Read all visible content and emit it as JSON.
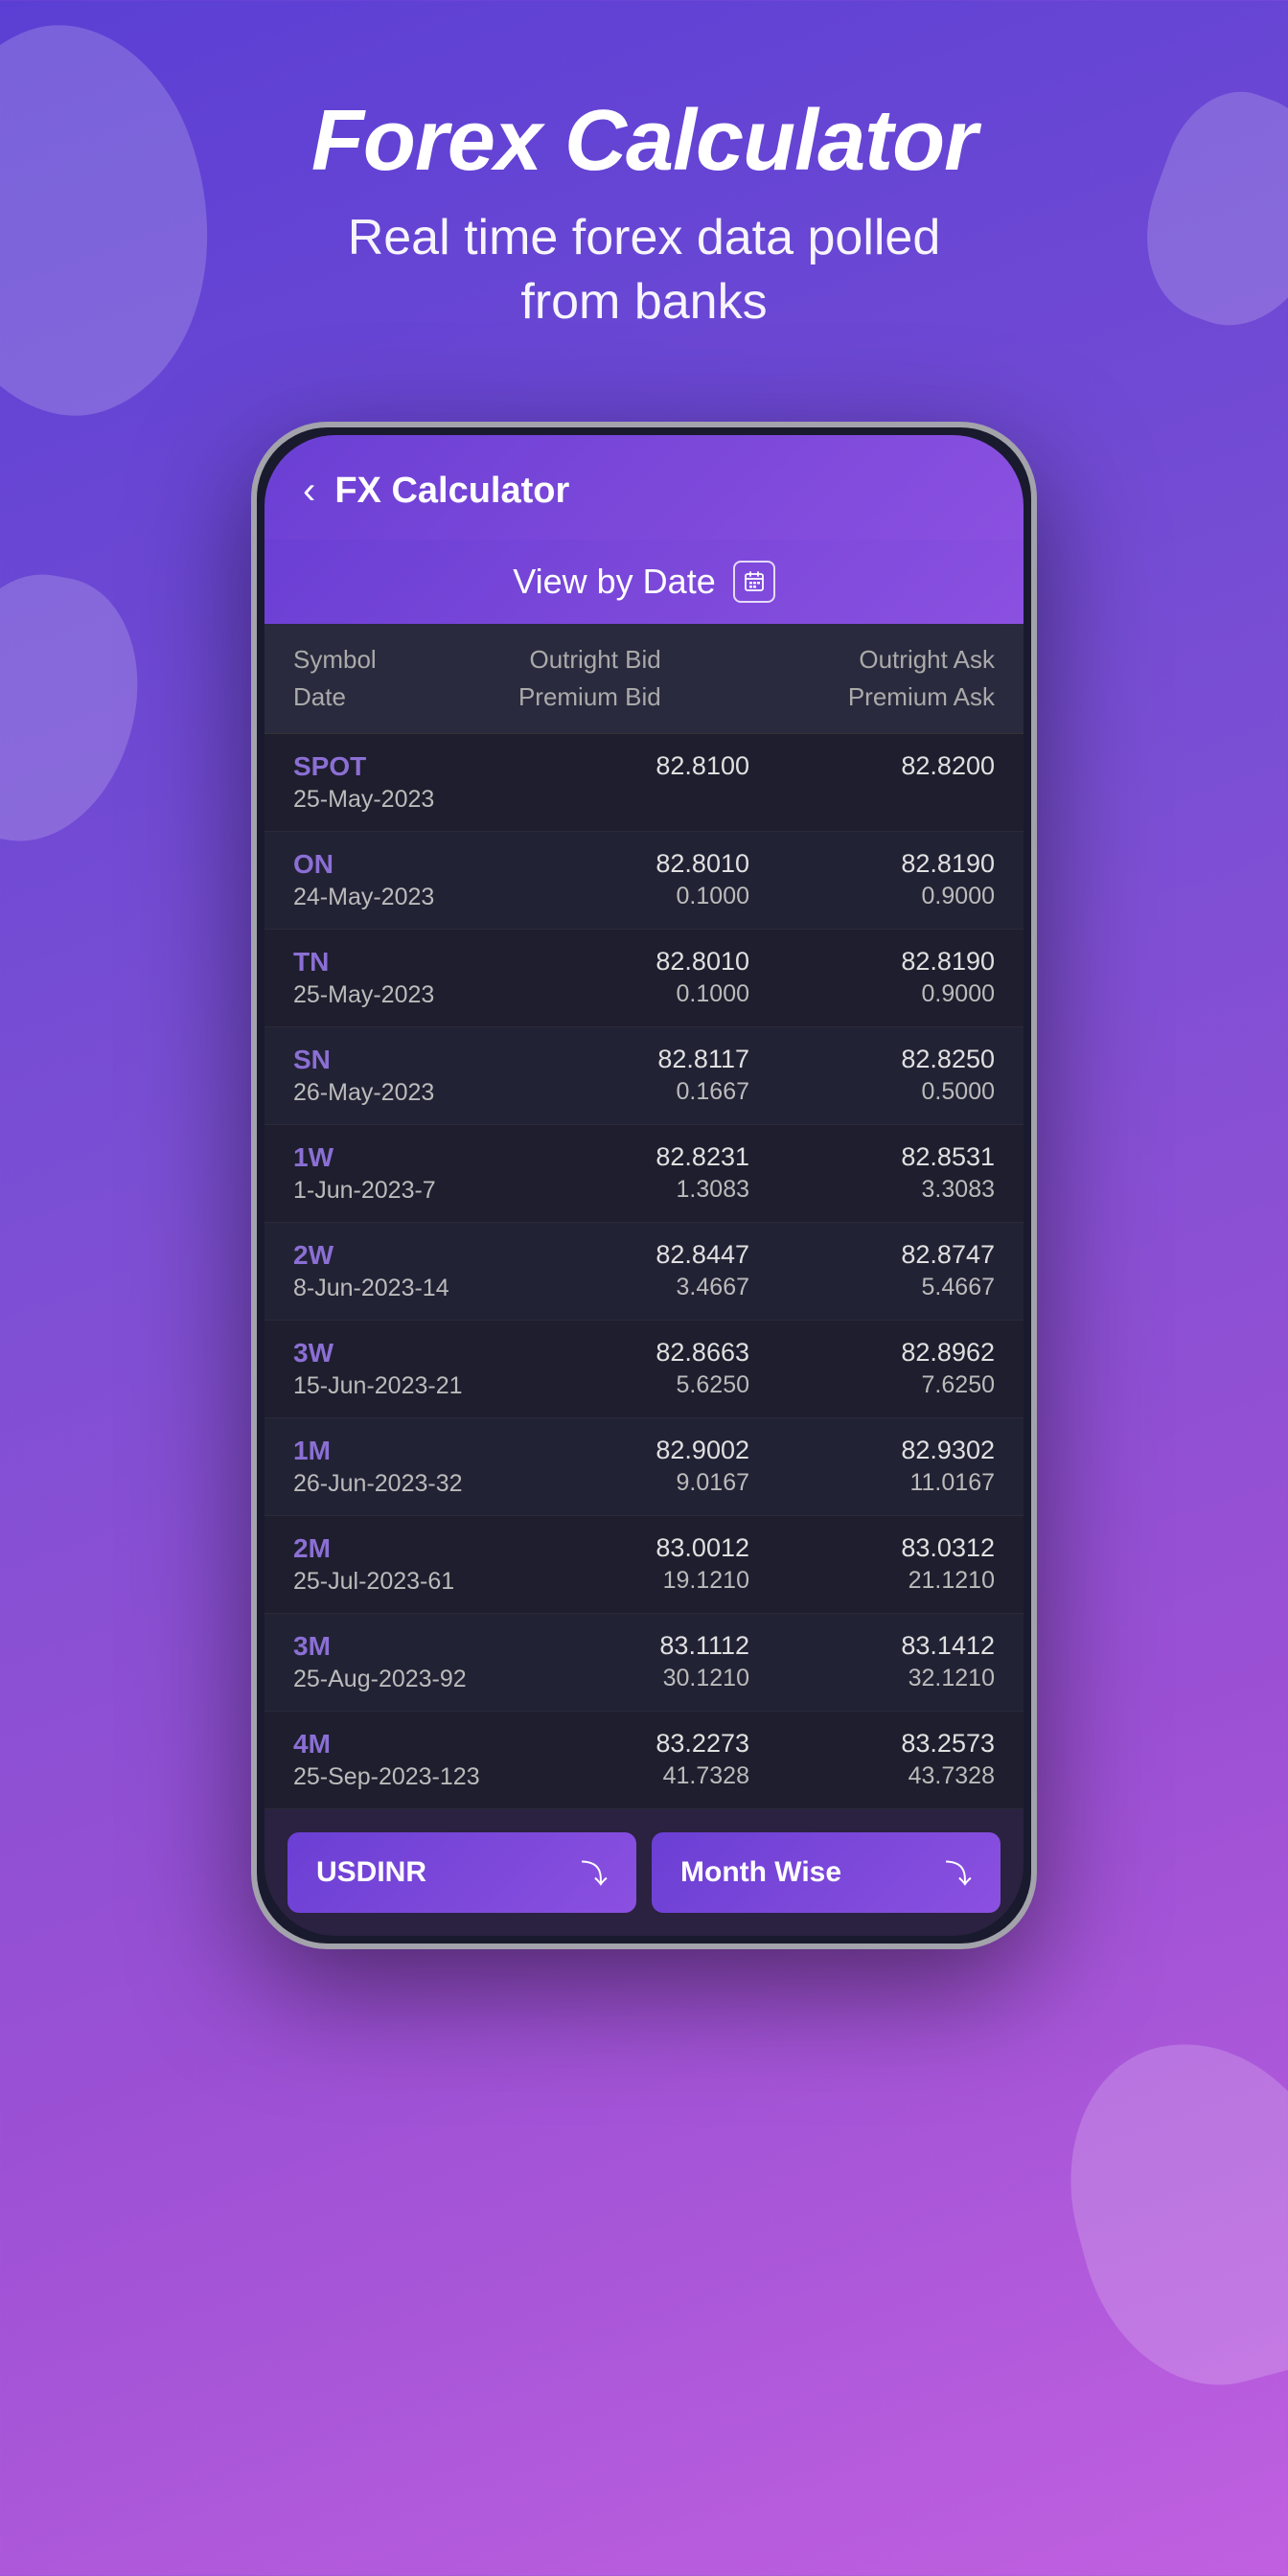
{
  "header": {
    "title": "Forex Calculator",
    "subtitle": "Real time forex data polled\nfrom banks"
  },
  "app": {
    "bar_title": "FX Calculator",
    "back_label": "‹",
    "view_date_label": "View by Date",
    "calendar_icon": "📅"
  },
  "table": {
    "col1_line1": "Symbol",
    "col1_line2": "Date",
    "col2_line1": "Outright Bid",
    "col2_line2": "Premium Bid",
    "col3_line1": "Outright Ask",
    "col3_line2": "Premium Ask"
  },
  "rows": [
    {
      "symbol": "SPOT",
      "date": "25-May-2023",
      "bid_main": "82.8100",
      "bid_sub": "",
      "ask_main": "82.8200",
      "ask_sub": ""
    },
    {
      "symbol": "ON",
      "date": "24-May-2023",
      "bid_main": "82.8010",
      "bid_sub": "0.1000",
      "ask_main": "82.8190",
      "ask_sub": "0.9000"
    },
    {
      "symbol": "TN",
      "date": "25-May-2023",
      "bid_main": "82.8010",
      "bid_sub": "0.1000",
      "ask_main": "82.8190",
      "ask_sub": "0.9000"
    },
    {
      "symbol": "SN",
      "date": "26-May-2023",
      "bid_main": "82.8117",
      "bid_sub": "0.1667",
      "ask_main": "82.8250",
      "ask_sub": "0.5000"
    },
    {
      "symbol": "1W",
      "date": "1-Jun-2023-7",
      "bid_main": "82.8231",
      "bid_sub": "1.3083",
      "ask_main": "82.8531",
      "ask_sub": "3.3083"
    },
    {
      "symbol": "2W",
      "date": "8-Jun-2023-14",
      "bid_main": "82.8447",
      "bid_sub": "3.4667",
      "ask_main": "82.8747",
      "ask_sub": "5.4667"
    },
    {
      "symbol": "3W",
      "date": "15-Jun-2023-21",
      "bid_main": "82.8663",
      "bid_sub": "5.6250",
      "ask_main": "82.8962",
      "ask_sub": "7.6250"
    },
    {
      "symbol": "1M",
      "date": "26-Jun-2023-32",
      "bid_main": "82.9002",
      "bid_sub": "9.0167",
      "ask_main": "82.9302",
      "ask_sub": "11.0167"
    },
    {
      "symbol": "2M",
      "date": "25-Jul-2023-61",
      "bid_main": "83.0012",
      "bid_sub": "19.1210",
      "ask_main": "83.0312",
      "ask_sub": "21.1210"
    },
    {
      "symbol": "3M",
      "date": "25-Aug-2023-92",
      "bid_main": "83.1112",
      "bid_sub": "30.1210",
      "ask_main": "83.1412",
      "ask_sub": "32.1210"
    },
    {
      "symbol": "4M",
      "date": "25-Sep-2023-123",
      "bid_main": "83.2273",
      "bid_sub": "41.7328",
      "ask_main": "83.2573",
      "ask_sub": "43.7328"
    }
  ],
  "bottom": {
    "currency_label": "USDINR",
    "currency_chevron": "⌄",
    "mode_label": "Month Wise",
    "mode_chevron": "⌄"
  }
}
